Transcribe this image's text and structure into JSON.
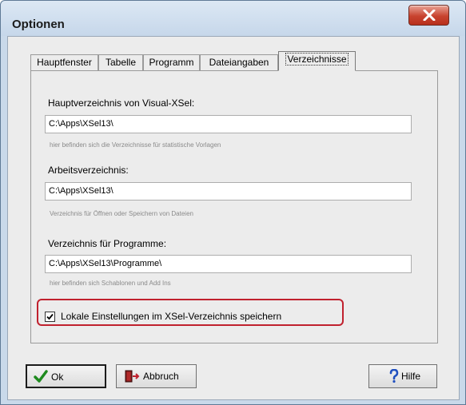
{
  "window": {
    "title": "Optionen",
    "close_icon": "close-icon"
  },
  "tabs": [
    {
      "label": "Hauptfenster",
      "active": false
    },
    {
      "label": "Tabelle",
      "active": false
    },
    {
      "label": "Programm",
      "active": false
    },
    {
      "label": "Dateiangaben",
      "active": false
    },
    {
      "label": "Verzeichnisse",
      "active": true
    }
  ],
  "directories": {
    "main": {
      "label": "Hauptverzeichnis von Visual-XSel:",
      "value": "C:\\Apps\\XSel13\\",
      "hint": "hier befinden sich die Verzeichnisse für statistische Vorlagen"
    },
    "work": {
      "label": "Arbeitsverzeichnis:",
      "value": "C:\\Apps\\XSel13\\",
      "hint": "Verzeichnis für Öffnen oder Speichern von Dateien"
    },
    "programs": {
      "label": "Verzeichnis für Programme:",
      "value": "C:\\Apps\\XSel13\\Programme\\",
      "hint": "hier befinden sich Schablonen und Add Ins"
    }
  },
  "local_settings": {
    "label": "Lokale Einstellungen im XSel-Verzeichnis speichern",
    "checked": true,
    "highlight_color": "#c0212e"
  },
  "buttons": {
    "ok": {
      "label": "Ok",
      "icon": "checkmark-icon"
    },
    "cancel": {
      "label": "Abbruch",
      "icon": "exit-door-icon"
    },
    "help": {
      "label": "Hilfe",
      "icon": "question-mark-icon"
    }
  },
  "colors": {
    "title_bar": "#c9d9ea",
    "close_button": "#c8432f",
    "ok_check": "#1e8a1e",
    "help_question": "#1f4fbf"
  }
}
